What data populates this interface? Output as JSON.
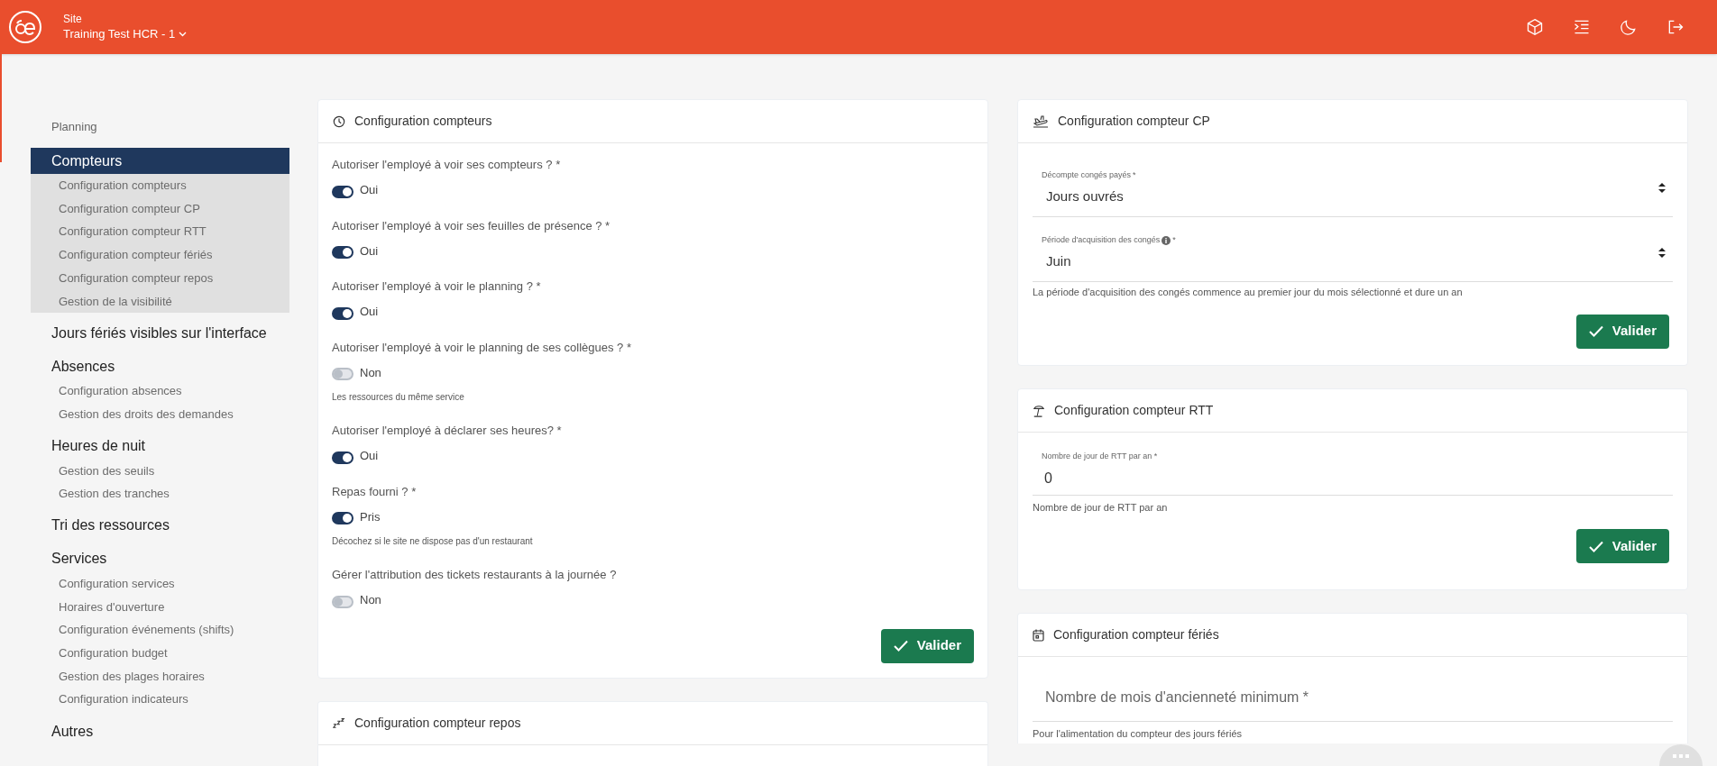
{
  "header": {
    "site_label": "Site",
    "site_name": "Training Test HCR - 1"
  },
  "sidebar": {
    "items": [
      {
        "label": "Planning",
        "kind": "link",
        "selected": false
      },
      {
        "label": "Compteurs",
        "kind": "group",
        "selected": true,
        "children": [
          {
            "label": "Configuration compteurs"
          },
          {
            "label": "Configuration compteur CP"
          },
          {
            "label": "Configuration compteur RTT"
          },
          {
            "label": "Configuration compteur fériés"
          },
          {
            "label": "Configuration compteur repos"
          },
          {
            "label": "Gestion de la visibilité"
          }
        ]
      },
      {
        "label": "Jours fériés visibles sur l'interface",
        "kind": "group",
        "selected": false
      },
      {
        "label": "Absences",
        "kind": "group",
        "selected": false,
        "children": [
          {
            "label": "Configuration absences"
          },
          {
            "label": "Gestion des droits des demandes"
          }
        ]
      },
      {
        "label": "Heures de nuit",
        "kind": "group",
        "selected": false,
        "children": [
          {
            "label": "Gestion des seuils"
          },
          {
            "label": "Gestion des tranches"
          }
        ]
      },
      {
        "label": "Tri des ressources",
        "kind": "group",
        "selected": false
      },
      {
        "label": "Services",
        "kind": "group",
        "selected": false,
        "children": [
          {
            "label": "Configuration services"
          },
          {
            "label": "Horaires d'ouverture"
          },
          {
            "label": "Configuration événements (shifts)"
          },
          {
            "label": "Configuration budget"
          },
          {
            "label": "Gestion des plages horaires"
          },
          {
            "label": "Configuration indicateurs"
          }
        ]
      },
      {
        "label": "Autres",
        "kind": "group",
        "selected": false
      }
    ]
  },
  "counters_config": {
    "title": "Configuration compteurs",
    "questions": [
      {
        "label": "Autoriser l'employé à voir ses compteurs ? *",
        "on": true,
        "value_label": "Oui"
      },
      {
        "label": "Autoriser l'employé à voir ses feuilles de présence ? *",
        "on": true,
        "value_label": "Oui"
      },
      {
        "label": "Autoriser l'employé à voir le planning ? *",
        "on": true,
        "value_label": "Oui"
      },
      {
        "label": "Autoriser l'employé à voir le planning de ses collègues ? *",
        "on": false,
        "value_label": "Non",
        "hint": "Les ressources du même service"
      },
      {
        "label": "Autoriser l'employé à déclarer ses heures? *",
        "on": true,
        "value_label": "Oui"
      },
      {
        "label": "Repas fourni ? *",
        "on": true,
        "value_label": "Pris",
        "hint": "Décochez si le site ne dispose pas d'un restaurant"
      },
      {
        "label": "Gérer l'attribution des tickets restaurants à la journée ?",
        "on": false,
        "value_label": "Non"
      }
    ],
    "submit": "Valider"
  },
  "rest_config": {
    "title": "Configuration compteur repos"
  },
  "cp_config": {
    "title": "Configuration compteur CP",
    "fields": [
      {
        "label": "Décompte congés payés",
        "required": "*",
        "info_icon": false,
        "value": "Jours ouvrés"
      },
      {
        "label": "Période d'acquisition des congés",
        "required": "*",
        "info_icon": true,
        "value": "Juin"
      }
    ],
    "hint": "La période d'acquisition des congés commence au premier jour du mois sélectionné et dure un an",
    "submit": "Valider"
  },
  "rtt_config": {
    "title": "Configuration compteur RTT",
    "field": {
      "label": "Nombre de jour de RTT par an *",
      "value": "0"
    },
    "hint": "Nombre de jour de RTT par an",
    "submit": "Valider"
  },
  "holidays_config": {
    "title": "Configuration compteur fériés",
    "field": {
      "placeholder": "Nombre de mois d'ancienneté minimum *"
    },
    "hint": "Pour l'alimentation du compteur des jours fériés"
  }
}
